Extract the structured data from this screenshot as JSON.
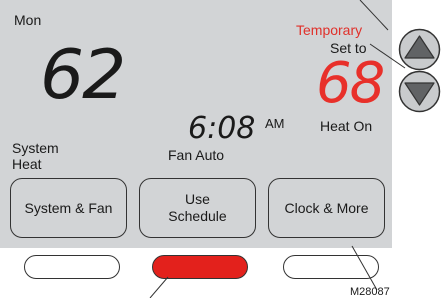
{
  "display": {
    "day": "Mon",
    "room_temp": "62",
    "time": "6:08",
    "ampm": "AM",
    "hold_status": "Temporary",
    "setpoint_label": "Set to",
    "setpoint": "68",
    "mode_status": "Heat On",
    "system_label": "System",
    "system_mode": "Heat",
    "fan_status": "Fan Auto"
  },
  "buttons": {
    "system_fan": "System & Fan",
    "use_schedule_line1": "Use",
    "use_schedule_line2": "Schedule",
    "clock_more": "Clock & More"
  },
  "indicators": {
    "active": "middle",
    "active_color": "#e3211c"
  },
  "arrows": {
    "up_icon": "up-arrow-icon",
    "down_icon": "down-arrow-icon"
  },
  "footer": {
    "model_code": "M28087"
  },
  "colors": {
    "screen": "#d2d4d6",
    "accent_red": "#e8302a"
  }
}
